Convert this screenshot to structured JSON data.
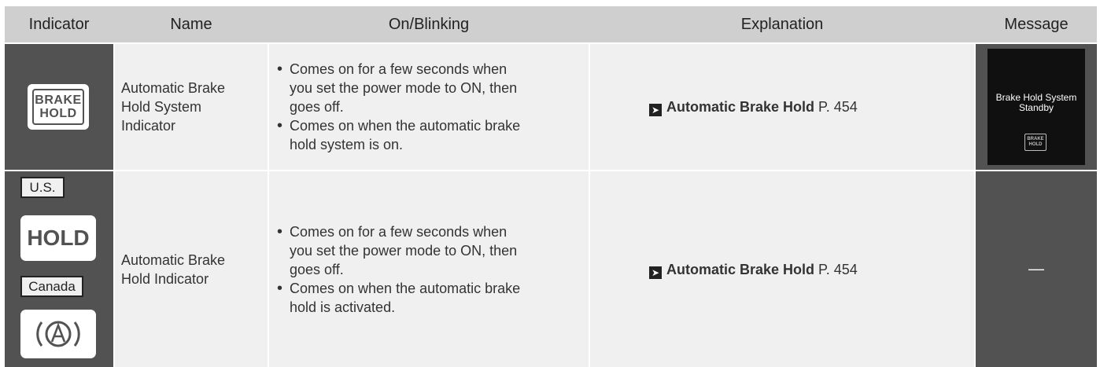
{
  "headers": {
    "indicator": "Indicator",
    "name": "Name",
    "on_blinking": "On/Blinking",
    "explanation": "Explanation",
    "message": "Message"
  },
  "rows": [
    {
      "indicator_icon": {
        "name": "brake-hold-icon",
        "line1": "BRAKE",
        "line2": "HOLD"
      },
      "name_lines": [
        "Automatic Brake",
        "Hold System",
        "Indicator"
      ],
      "bullets": [
        [
          "Comes on for a few seconds when",
          "you set the power mode to ON, then",
          "goes off."
        ],
        [
          "Comes on when the automatic brake",
          "hold system is on."
        ]
      ],
      "explanation": {
        "title": "Automatic Brake Hold",
        "page": " P. 454"
      },
      "message": {
        "line1": "Brake Hold System",
        "line2": "Standby",
        "icon_line1": "BRAKE",
        "icon_line2": "HOLD"
      }
    },
    {
      "tags": {
        "us": "U.S.",
        "canada": "Canada"
      },
      "hold_icon_text": "HOLD",
      "a_icon_name": "brake-hold-a-icon",
      "name_lines": [
        "Automatic Brake",
        "Hold Indicator"
      ],
      "bullets": [
        [
          "Comes on for a few seconds when",
          "you set the power mode to ON, then",
          "goes off."
        ],
        [
          "Comes on when the automatic brake",
          "hold is activated."
        ]
      ],
      "explanation": {
        "title": "Automatic Brake Hold",
        "page": " P. 454"
      },
      "message": "—"
    }
  ],
  "colors": {
    "header_bg": "#cfcfcf",
    "icon_cell_bg": "#525252",
    "text_cell_bg": "#f0f0f0"
  }
}
